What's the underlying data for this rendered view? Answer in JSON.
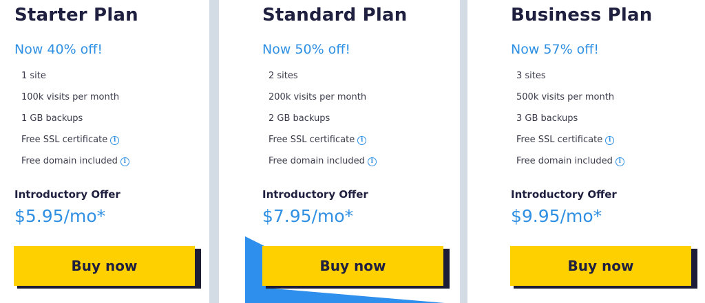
{
  "colors": {
    "title": "#1f1f3f",
    "accent_blue": "#2e8fe3",
    "button_yellow": "#ffd000",
    "button_shadow": "#1d1d37",
    "deco_blue": "#2f8fec",
    "background": "#d3dbe4"
  },
  "info_icon_glyph": "i",
  "plans": [
    {
      "title": "Starter Plan",
      "discount": "Now 40% off!",
      "features": [
        {
          "text": "1 site",
          "info": false
        },
        {
          "text": "100k visits per month",
          "info": false
        },
        {
          "text": "1 GB backups",
          "info": false
        },
        {
          "text": "Free SSL certificate",
          "info": true
        },
        {
          "text": "Free domain included",
          "info": true
        }
      ],
      "offer_label": "Introductory Offer",
      "price": "$5.95/mo*",
      "button_label": "Buy now"
    },
    {
      "title": "Standard Plan",
      "discount": "Now 50% off!",
      "features": [
        {
          "text": "2 sites",
          "info": false
        },
        {
          "text": "200k visits per month",
          "info": false
        },
        {
          "text": "2 GB backups",
          "info": false
        },
        {
          "text": "Free SSL certificate",
          "info": true
        },
        {
          "text": "Free domain included",
          "info": true
        }
      ],
      "offer_label": "Introductory Offer",
      "price": "$7.95/mo*",
      "button_label": "Buy now"
    },
    {
      "title": "Business Plan",
      "discount": "Now 57% off!",
      "features": [
        {
          "text": "3 sites",
          "info": false
        },
        {
          "text": "500k visits per month",
          "info": false
        },
        {
          "text": "3 GB backups",
          "info": false
        },
        {
          "text": "Free SSL certificate",
          "info": true
        },
        {
          "text": "Free domain included",
          "info": true
        }
      ],
      "offer_label": "Introductory Offer",
      "price": "$9.95/mo*",
      "button_label": "Buy now"
    }
  ]
}
